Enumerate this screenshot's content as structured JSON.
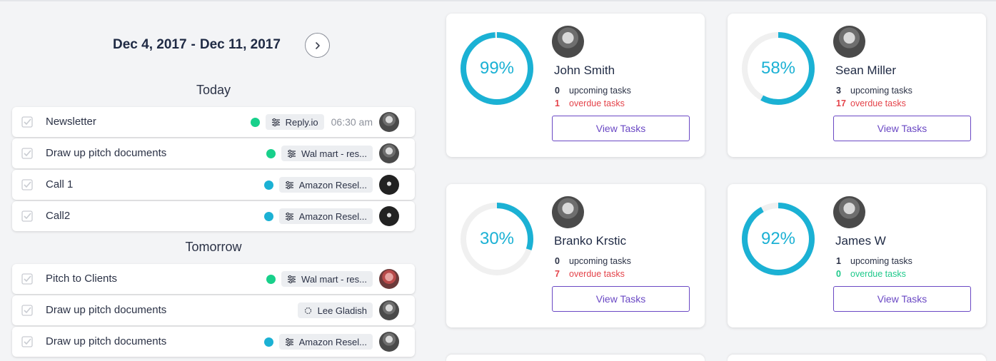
{
  "header": {
    "date_start": "Dec 4, 2017",
    "separator": "-",
    "date_end": "Dec 11, 2017"
  },
  "sections": {
    "today": "Today",
    "tomorrow": "Tomorrow"
  },
  "tasks": [
    {
      "title": "Newsletter",
      "dot": "#18d08b",
      "tag": "Reply.io",
      "time": "06:30 am"
    },
    {
      "title": "Draw up pitch documents",
      "dot": "#18d08b",
      "tag": "Wal mart - res..."
    },
    {
      "title": "Call 1",
      "dot": "#1bb1d4",
      "tag": "Amazon Resel..."
    },
    {
      "title": "Call2",
      "dot": "#1bb1d4",
      "tag": "Amazon Resel..."
    },
    {
      "title": "Pitch to Clients",
      "dot": "#18d08b",
      "tag": "Wal mart - res..."
    },
    {
      "title": "Draw up pitch documents",
      "tag": "Lee Gladish"
    },
    {
      "title": "Draw up pitch documents",
      "dot": "#1bb1d4",
      "tag": "Amazon Resel..."
    }
  ],
  "people": [
    {
      "name": "John Smith",
      "percent": "99%",
      "progress": 0.99,
      "upcoming": "0",
      "upcoming_label": "upcoming tasks",
      "overdue": "1",
      "overdue_label": "overdue tasks",
      "button": "View Tasks"
    },
    {
      "name": "Sean Miller",
      "percent": "58%",
      "progress": 0.58,
      "upcoming": "3",
      "upcoming_label": "upcoming tasks",
      "overdue": "17",
      "overdue_label": "overdue tasks",
      "button": "View Tasks"
    },
    {
      "name": "Branko Krstic",
      "percent": "30%",
      "progress": 0.3,
      "upcoming": "0",
      "upcoming_label": "upcoming tasks",
      "overdue": "7",
      "overdue_label": "overdue tasks",
      "button": "View Tasks"
    },
    {
      "name": "James W",
      "percent": "92%",
      "progress": 0.92,
      "upcoming": "1",
      "upcoming_label": "upcoming tasks",
      "overdue": "0",
      "overdue_label": "overdue tasks",
      "button": "View Tasks"
    }
  ],
  "colors": {
    "ring": "#1bb1d4",
    "ring_track": "#f0f0f0",
    "overdue": "#e4434a",
    "no_overdue": "#1fc98b",
    "button": "#6a48c4",
    "dot_green": "#18d08b",
    "dot_blue": "#1bb1d4"
  },
  "icons": {
    "check": "checkbox-icon",
    "tag": "sliders-icon",
    "contact_tag": "target-icon",
    "next": "chevron-right-icon"
  }
}
